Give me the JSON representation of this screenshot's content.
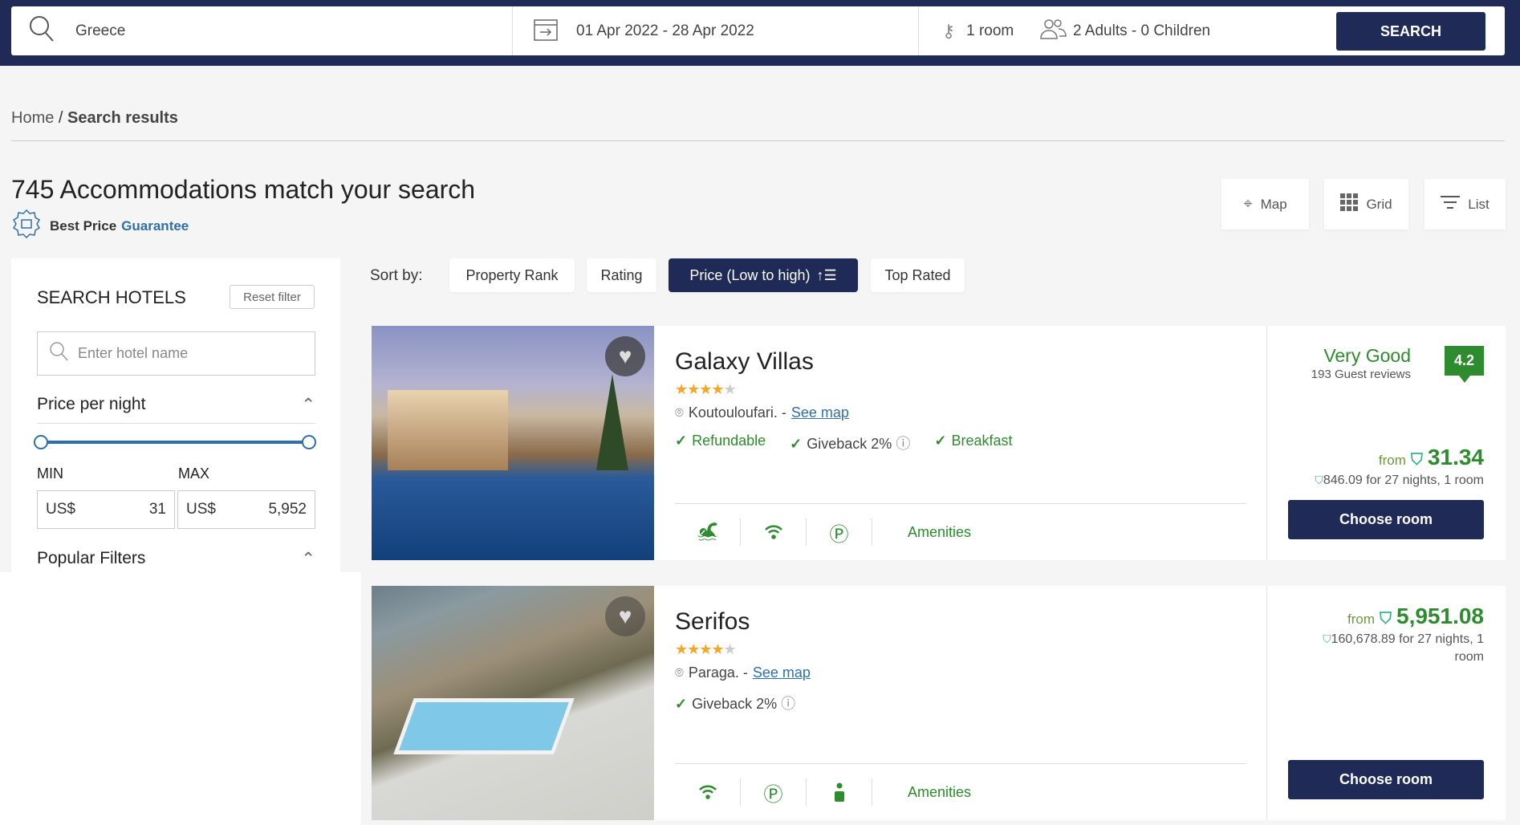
{
  "search": {
    "destination": "Greece",
    "dates": "01 Apr 2022 - 28 Apr 2022",
    "rooms": "1 room",
    "guests": "2 Adults - 0 Children",
    "button": "SEARCH"
  },
  "breadcrumb": {
    "home": "Home",
    "sep": " / ",
    "current": "Search results"
  },
  "title": "745 Accommodations match your search",
  "best_price": {
    "text": "Best Price",
    "link": "Guarantee"
  },
  "views": {
    "map": "Map",
    "grid": "Grid",
    "list": "List"
  },
  "sidebar": {
    "title": "SEARCH HOTELS",
    "reset": "Reset filter",
    "hotel_placeholder": "Enter hotel name",
    "price_heading": "Price per night",
    "min_label": "MIN",
    "max_label": "MAX",
    "currency": "US$",
    "min_value": "31",
    "max_value": "5,952",
    "popular": "Popular Filters"
  },
  "sort": {
    "label": "Sort by:",
    "options": [
      "Property Rank",
      "Rating",
      "Price (Low to high)",
      "Top Rated"
    ],
    "active": 2
  },
  "colors": {
    "navy": "#1f2a56",
    "green": "#2e8b2e",
    "link": "#2f6fa8"
  },
  "hotels": [
    {
      "name": "Galaxy Villas",
      "stars": 4,
      "location": "Koutouloufari. -",
      "see_map": "See map",
      "features": [
        "Refundable",
        "Giveback 2%",
        "Breakfast"
      ],
      "amenities": [
        "pool-icon",
        "wifi-icon",
        "parking-icon"
      ],
      "amenities_label": "Amenities",
      "rating_text": "Very Good",
      "reviews": "193 Guest reviews",
      "score": "4.2",
      "from": "from",
      "price": "31.34",
      "total": "846.09 for 27 nights, 1 room",
      "button": "Choose room"
    },
    {
      "name": "Serifos",
      "stars": 4,
      "location": "Paraga. -",
      "see_map": "See map",
      "features": [
        "Giveback 2%"
      ],
      "amenities": [
        "wifi-icon",
        "parking-icon",
        "concierge-icon"
      ],
      "amenities_label": "Amenities",
      "from": "from",
      "price": "5,951.08",
      "total": "160,678.89 for 27 nights, 1 room",
      "button": "Choose room"
    }
  ]
}
